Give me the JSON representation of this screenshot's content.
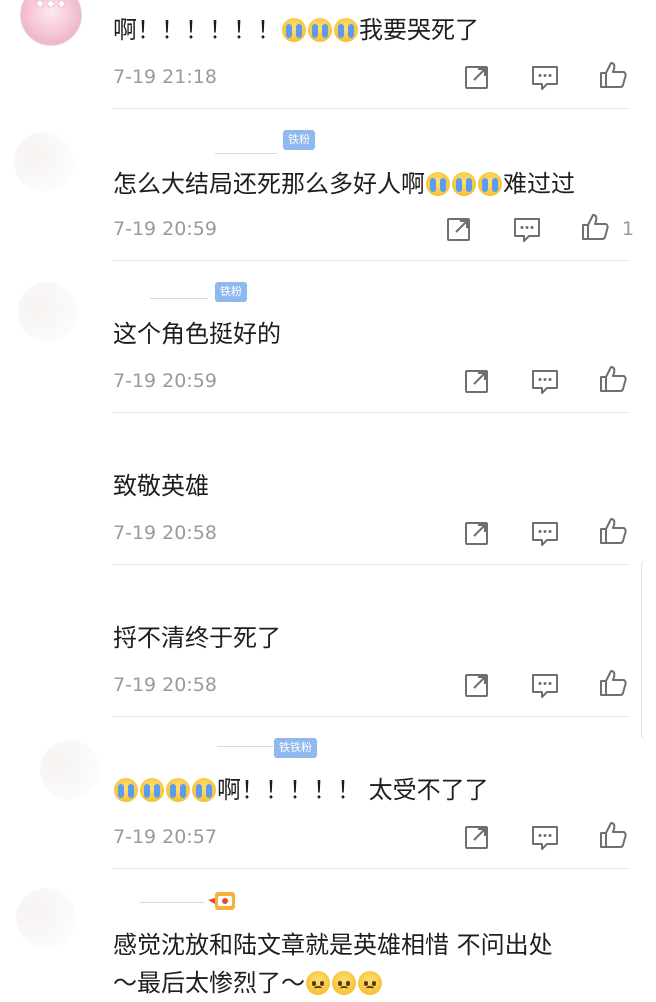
{
  "comments": [
    {
      "text": "啊！！！！！！",
      "emojis_after": [
        "cry",
        "cry",
        "cry"
      ],
      "text_after": "我要哭死了",
      "time": "7-19 21:18",
      "like_count": "",
      "fan_badge": ""
    },
    {
      "text": "怎么大结局还死那么多好人啊",
      "emojis_after": [
        "cry",
        "cry",
        "cry"
      ],
      "text_after": "难过过",
      "time": "7-19 20:59",
      "like_count": "1",
      "fan_badge": "铁粉"
    },
    {
      "text": "这个角色挺好的",
      "time": "7-19 20:59",
      "like_count": "",
      "fan_badge": "铁粉"
    },
    {
      "text": "致敬英雄",
      "time": "7-19 20:58",
      "like_count": "",
      "fan_badge": ""
    },
    {
      "text": "捋不清终于死了",
      "time": "7-19 20:58",
      "like_count": "",
      "fan_badge": ""
    },
    {
      "emojis_before": [
        "cry",
        "cry",
        "cry",
        "cry"
      ],
      "text": "啊！！！！！ 太受不了了",
      "time": "7-19 20:57",
      "like_count": "",
      "fan_badge": "铁铁粉"
    },
    {
      "text_line1": "感觉沈放和陆文章就是英雄相惜 不问出处",
      "text_line2": "～最后太惨烈了～",
      "emojis_after": [
        "sad",
        "sad",
        "sad"
      ],
      "fan_badge": ""
    }
  ],
  "colors": {
    "fan_badge_bg": "#8fb8ee",
    "time_text": "#9a9a9a",
    "icon_stroke": "#6f6f6f"
  },
  "icons": {
    "share": "share-icon",
    "comment": "comment-icon",
    "like": "like-icon"
  }
}
